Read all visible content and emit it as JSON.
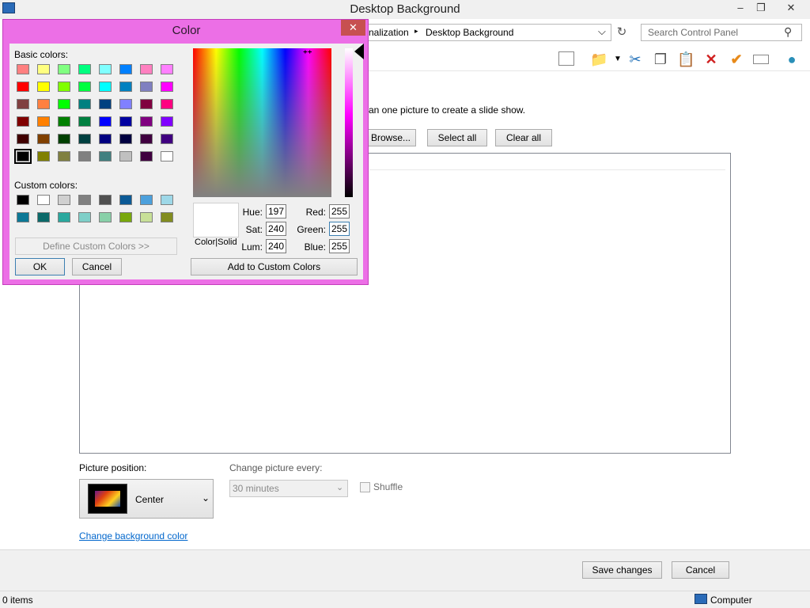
{
  "window": {
    "title": "Desktop Background",
    "minimize": "–",
    "maximize": "❐",
    "close": "✕"
  },
  "address": {
    "crumb_1": "nalization",
    "separator": "▸",
    "crumb_2": "Desktop Background",
    "dropdown": "⌵",
    "refresh": "↻"
  },
  "search": {
    "placeholder": "Search Control Panel",
    "icon": "⚲"
  },
  "toolbar": {
    "icons": [
      "layout-icon",
      "folder-check-icon",
      "cut-icon",
      "copy-icon",
      "paste-icon",
      "delete-icon",
      "check-icon",
      "rename-icon",
      "globe-icon"
    ]
  },
  "content": {
    "instruction": "an one picture to create a slide show.",
    "browse_label": "Browse...",
    "select_all_label": "Select all",
    "clear_all_label": "Clear all"
  },
  "picture_position": {
    "label": "Picture position:",
    "value": "Center"
  },
  "change_picture": {
    "label": "Change picture every:",
    "value": "30 minutes"
  },
  "shuffle": {
    "label": "Shuffle",
    "checked": false
  },
  "bg_color_link": "Change background color",
  "footer": {
    "save_label": "Save changes",
    "cancel_label": "Cancel"
  },
  "status": {
    "items": "0 items",
    "computer": "Computer"
  },
  "color_dialog": {
    "title": "Color",
    "close": "✕",
    "basic_colors_label": "Basic colors:",
    "basic_colors": [
      [
        "#ff8080",
        "#ffff80",
        "#80ff80",
        "#00ff80",
        "#80ffff",
        "#0080ff",
        "#ff80c0",
        "#ff80ff"
      ],
      [
        "#ff0000",
        "#ffff00",
        "#80ff00",
        "#00ff40",
        "#00ffff",
        "#0080c0",
        "#8080c0",
        "#ff00ff"
      ],
      [
        "#804040",
        "#ff8040",
        "#00ff00",
        "#008080",
        "#004080",
        "#8080ff",
        "#800040",
        "#ff0080"
      ],
      [
        "#800000",
        "#ff8000",
        "#008000",
        "#008040",
        "#0000ff",
        "#0000a0",
        "#800080",
        "#8000ff"
      ],
      [
        "#400000",
        "#804000",
        "#004000",
        "#004040",
        "#000080",
        "#000040",
        "#400040",
        "#400080"
      ],
      [
        "#000000",
        "#808000",
        "#808040",
        "#808080",
        "#408080",
        "#c0c0c0",
        "#400040",
        "#ffffff"
      ]
    ],
    "custom_colors_label": "Custom colors:",
    "custom_colors": [
      [
        "#000000",
        "#ffffff",
        "#d0d0d0",
        "#808080",
        "#505050",
        "#0c5a96",
        "#4ca0dc",
        "#9ed8e8"
      ],
      [
        "#0c7896",
        "#0c6a6a",
        "#2aa89e",
        "#7ecfc8",
        "#88d0a8",
        "#78a80c",
        "#c8e098",
        "#828c20"
      ]
    ],
    "define_custom_label": "Define Custom Colors >>",
    "ok_label": "OK",
    "cancel_label": "Cancel",
    "color_solid_label": "Color|Solid",
    "hue_label": "Hue:",
    "hue": "197",
    "sat_label": "Sat:",
    "sat": "240",
    "lum_label": "Lum:",
    "lum": "240",
    "red_label": "Red:",
    "red": "255",
    "green_label": "Green:",
    "green": "255",
    "blue_label": "Blue:",
    "blue": "255",
    "add_custom_label": "Add to Custom Colors"
  }
}
